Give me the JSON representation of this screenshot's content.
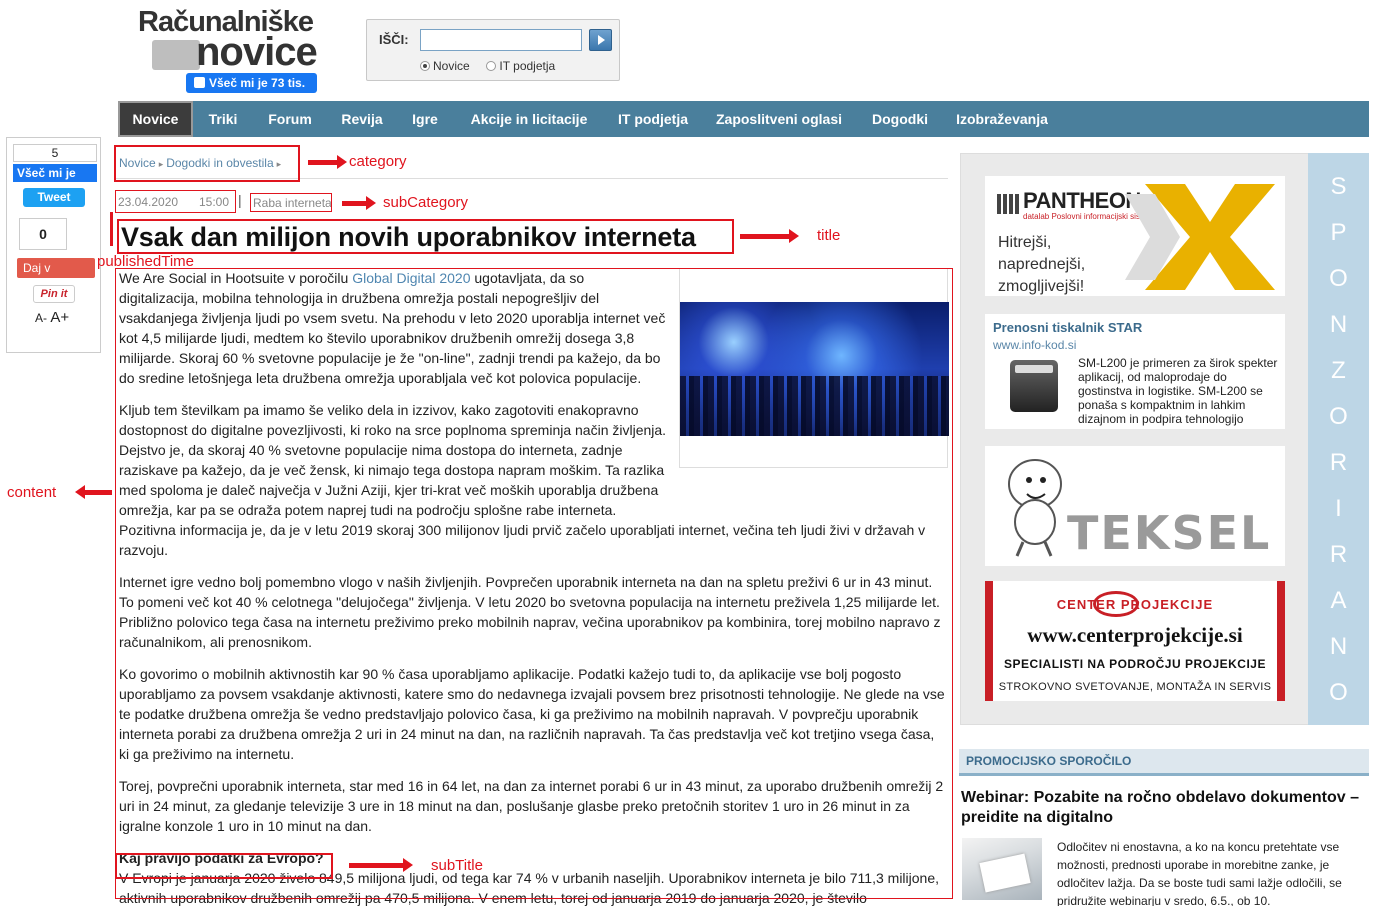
{
  "header": {
    "logo_line1": "Računalniške",
    "logo_line2": "novice",
    "fb_like": "Všeč mi je 73 tis.",
    "search_label": "IŠČI:",
    "search_value": "",
    "radio_options": [
      "Novice",
      "IT podjetja"
    ],
    "radio_selected": "Novice"
  },
  "nav": {
    "items": [
      "Novice",
      "Triki",
      "Forum",
      "Revija",
      "Igre",
      "Akcije in licitacije",
      "IT podjetja",
      "Zaposlitveni oglasi",
      "Dogodki",
      "Izobraževanja"
    ],
    "active": "Novice"
  },
  "share": {
    "like_count": "5",
    "like_label": "Všeč mi je",
    "tweet": "Tweet",
    "share_count": "0",
    "daj_v": "Daj v",
    "pin": "Pin it",
    "font_small": "A-",
    "font_large": "A+"
  },
  "article": {
    "breadcrumb": [
      "Novice",
      "Dogodki in obvestila"
    ],
    "date": "23.04.2020",
    "time": "15:00",
    "subcategory": "Raba interneta",
    "title": "Vsak dan milijon novih uporabnikov interneta",
    "p1_before_link": "We Are Social in Hootsuite v poročilu ",
    "p1_link": "Global Digital 2020",
    "p1_after_link": " ugotavljata, da so digitalizacija, mobilna tehnologija in družbena omrežja postali nepogrešljiv del vsakdanjega življenja ljudi po vsem svetu. Na prehodu v leto 2020 uporablja internet več kot 4,5 milijarde ljudi, medtem ko število uporabnikov družbenih omrežij dosega 3,8 milijarde. Skoraj 60 % svetovne populacije je že \"on-line\", zadnji trendi pa kažejo, da bo do sredine letošnjega leta družbena omrežja uporabljala več kot polovica populacije.",
    "p2": "Kljub tem številkam pa imamo še veliko dela in izzivov, kako zagotoviti enakopravno dostopnost do digitalne povezljivosti, ki roko na srce poplnoma spreminja način življenja. Dejstvo je, da skoraj 40 % svetovne populacije nima dostopa do interneta, zadnje raziskave pa kažejo, da je več žensk, ki nimajo tega dostopa napram moškim. Ta razlika med spoloma je daleč največja v Južni Aziji, kjer tri-krat več moških uporablja družbena omrežja, kar pa se odraža potem naprej tudi na področju splošne rabe interneta.",
    "p2b": "Pozitivna informacija je, da je v letu 2019 skoraj 300 milijonov ljudi prvič začelo uporabljati internet, večina teh ljudi živi v državah v razvoju.",
    "p3": "Internet igre vedno bolj pomembno vlogo v naših življenjih. Povprečen uporabnik interneta na dan na spletu preživi 6 ur in 43 minut. To pomeni več kot 40 % celotnega \"delujočega\" življenja. V letu 2020 bo svetovna populacija na internetu preživela 1,25 milijarde let. Približno polovico tega časa na internetu preživimo preko mobilnih naprav, večina uporabnikov pa kombinira, torej mobilno napravo z računalnikom, ali prenosnikom.",
    "p4": "Ko govorimo o mobilnih aktivnostih kar 90 % časa uporabljamo aplikacije. Podatki kažejo tudi to, da aplikacije vse bolj pogosto uporabljamo za povsem vsakdanje aktivnosti, katere smo do nedavnega izvajali povsem brez prisotnosti tehnologije. Ne glede na vse te podatke družbena omrežja še vedno predstavljajo polovico časa, ki ga preživimo na mobilnih napravah. V povprečju uporabnik interneta porabi za družbena omrežja 2 uri in 24 minut na dan, na različnih napravah. Ta čas predstavlja več kot tretjino vsega časa, ki ga preživimo na internetu.",
    "p5": "Torej, povprečni uporabnik interneta, star med 16 in 64 let, na dan za internet porabi 6 ur in 43 minut, za uporabo družbenih omrežij 2 uri in 24 minut, za gledanje televizije 3 ure in 18 minut na dan, poslušanje glasbe preko pretočnih storitev 1 uro in 26 minut in za igralne konzole 1 uro in 10 minut na dan.",
    "subtitle": "Kaj pravijo podatki za Evropo?",
    "p6": "V Evropi je januarja 2020 živelo 849,5 milijona ljudi, od tega kar 74 % v urbanih naseljih. Uporabnikov interneta je bilo 711,3 milijone, aktivnih uporabnikov družbenih omrežij pa 470,5 milijona. V enem letu, torej od januarja 2019 do januarja 2020, je število"
  },
  "annotations": {
    "category": "category",
    "subCategory": "subCategory",
    "title": "title",
    "publishedTime": "publishedTime",
    "content": "content",
    "subTitle": "subTitle"
  },
  "sidebar": {
    "sponz_letters": [
      "S",
      "P",
      "O",
      "N",
      "Z",
      "O",
      "R",
      "I",
      "R",
      "A",
      "N",
      "O"
    ],
    "pantheon_brand": "PANTHEON",
    "pantheon_sub": "datalab Poslovni informacijski sistem",
    "pantheon_tag": "Hitrejši, naprednejši, zmogljivejši!",
    "star_title": "Prenosni tiskalnik STAR",
    "star_url": "www.info-kod.si",
    "star_text": "SM-L200 je primeren za širok spekter aplikacij, od maloprodaje do gostinstva in logistike. SM-L200 se ponaša s kompaktnim in lahkim dizajnom in podpira tehnologijo",
    "teksel": "TEKSEL",
    "cp_line1": "CENTER  PROJEKCIJE",
    "cp_line2": "www.centerprojekcije.si",
    "cp_line3": "SPECIALISTI NA PODROČJU PROJEKCIJE",
    "cp_line4": "STROKOVNO SVETOVANJE, MONTAŽA IN SERVIS",
    "promo_header": "PROMOCIJSKO SPOROČILO",
    "promo_title": "Webinar: Pozabite na ročno obdelavo dokumentov – preidite na digitalno",
    "promo_text": "Odločitev ni enostavna, a ko na koncu pretehtate vse možnosti, prednosti uporabe in morebitne zanke, je odločitev lažja. Da se boste tudi sami lažje odločili, se pridružite webinarju v sredo, 6.5., ob 10."
  },
  "colors": {
    "nav": "#4a7f9c",
    "annotation": "#e0141e",
    "link": "#4f86b0",
    "sponz": "#bdd6e6"
  }
}
